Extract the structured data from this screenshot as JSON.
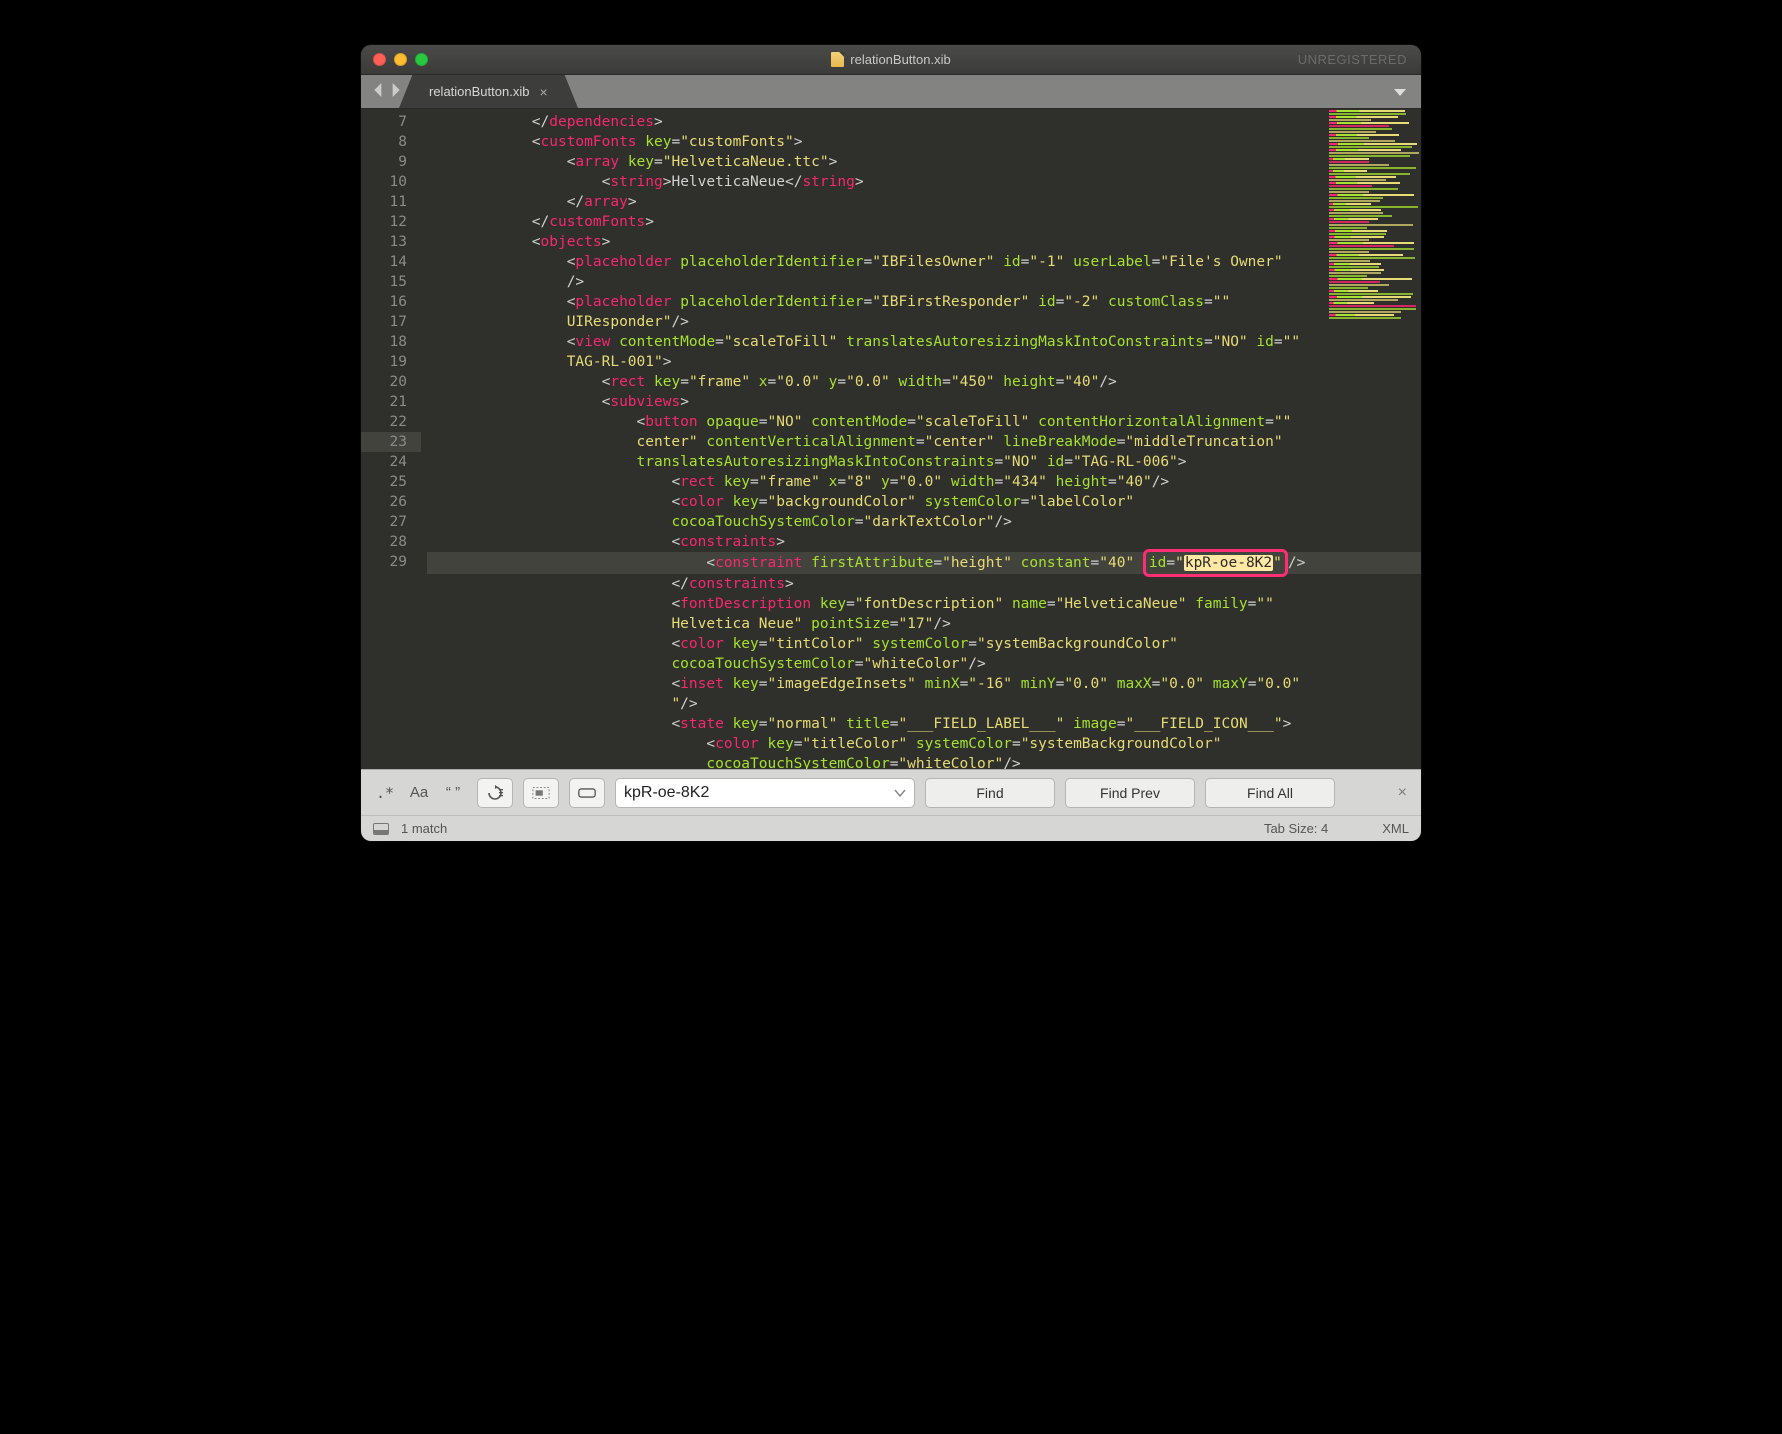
{
  "window": {
    "title": "relationButton.xib",
    "unregistered": "UNREGISTERED"
  },
  "tab": {
    "label": "relationButton.xib",
    "close": "×"
  },
  "gutter_start": 7,
  "highlight_line": 23,
  "lines": [
    {
      "n": 7,
      "indent": 3,
      "pre": "</",
      "tag": "dependencies",
      "post": ">"
    },
    {
      "n": 8,
      "indent": 3,
      "pre": "<",
      "tag": "customFonts",
      "attrs": [
        [
          "key",
          "customFonts"
        ]
      ],
      "post": ">"
    },
    {
      "n": 9,
      "indent": 4,
      "pre": "<",
      "tag": "array",
      "attrs": [
        [
          "key",
          "HelveticaNeue.ttc"
        ]
      ],
      "post": ">"
    },
    {
      "n": 10,
      "indent": 5,
      "pre": "<",
      "tag": "string",
      "post_text": ">HelveticaNeue</",
      "tag2": "string",
      "post2": ">"
    },
    {
      "n": 11,
      "indent": 4,
      "pre": "</",
      "tag": "array",
      "post": ">"
    },
    {
      "n": 12,
      "indent": 3,
      "pre": "</",
      "tag": "customFonts",
      "post": ">"
    },
    {
      "n": 13,
      "indent": 3,
      "pre": "<",
      "tag": "objects",
      "post": ">"
    },
    {
      "n": 14,
      "indent": 4,
      "pre": "<",
      "tag": "placeholder",
      "attrs": [
        [
          "placeholderIdentifier",
          "IBFilesOwner"
        ],
        [
          "id",
          "-1"
        ],
        [
          "userLabel",
          "File's Owner"
        ]
      ],
      "post": "",
      "wrap_close": "/>"
    },
    {
      "n": 15,
      "indent": 4,
      "pre": "<",
      "tag": "placeholder",
      "attrs": [
        [
          "placeholderIdentifier",
          "IBFirstResponder"
        ],
        [
          "id",
          "-2"
        ],
        [
          "customClass",
          ""
        ]
      ],
      "post": "",
      "wrap_text": "UIResponder\"",
      "wrap_close": "/>"
    },
    {
      "n": 16,
      "indent": 4,
      "pre": "<",
      "tag": "view",
      "attrs": [
        [
          "contentMode",
          "scaleToFill"
        ],
        [
          "translatesAutoresizingMaskIntoConstraints",
          "NO"
        ],
        [
          "id",
          ""
        ]
      ],
      "post": "",
      "wrap_text": "TAG-RL-001\"",
      "wrap_close": ">"
    },
    {
      "n": 17,
      "indent": 5,
      "pre": "<",
      "tag": "rect",
      "attrs": [
        [
          "key",
          "frame"
        ],
        [
          "x",
          "0.0"
        ],
        [
          "y",
          "0.0"
        ],
        [
          "width",
          "450"
        ],
        [
          "height",
          "40"
        ]
      ],
      "post": "/>"
    },
    {
      "n": 18,
      "indent": 5,
      "pre": "<",
      "tag": "subviews",
      "post": ">"
    },
    {
      "n": 19,
      "indent": 6,
      "pre": "<",
      "tag": "button",
      "attrs": [
        [
          "opaque",
          "NO"
        ],
        [
          "contentMode",
          "scaleToFill"
        ],
        [
          "contentHorizontalAlignment",
          ""
        ]
      ],
      "post": "",
      "wrap_lines": [
        "center\" contentVerticalAlignment=\"center\" lineBreakMode=\"middleTruncation\"",
        "translatesAutoresizingMaskIntoConstraints=\"NO\" id=\"TAG-RL-006\">"
      ]
    },
    {
      "n": 20,
      "indent": 7,
      "pre": "<",
      "tag": "rect",
      "attrs": [
        [
          "key",
          "frame"
        ],
        [
          "x",
          "8"
        ],
        [
          "y",
          "0.0"
        ],
        [
          "width",
          "434"
        ],
        [
          "height",
          "40"
        ]
      ],
      "post": "/>"
    },
    {
      "n": 21,
      "indent": 7,
      "pre": "<",
      "tag": "color",
      "attrs": [
        [
          "key",
          "backgroundColor"
        ],
        [
          "systemColor",
          "labelColor"
        ]
      ],
      "post": "",
      "wrap_lines": [
        "cocoaTouchSystemColor=\"darkTextColor\"/>"
      ]
    },
    {
      "n": 22,
      "indent": 7,
      "pre": "<",
      "tag": "constraints",
      "post": ">"
    },
    {
      "n": 23,
      "indent": 8,
      "pre": "<",
      "tag": "constraint",
      "attrs": [
        [
          "firstAttribute",
          "height"
        ],
        [
          "constant",
          "40"
        ]
      ],
      "post": "",
      "hit_attr": [
        "id",
        "kpR-oe-8K2"
      ],
      "post_end": "/>"
    },
    {
      "n": 24,
      "indent": 7,
      "pre": "</",
      "tag": "constraints",
      "post": ">"
    },
    {
      "n": 25,
      "indent": 7,
      "pre": "<",
      "tag": "fontDescription",
      "attrs": [
        [
          "key",
          "fontDescription"
        ],
        [
          "name",
          "HelveticaNeue"
        ],
        [
          "family",
          ""
        ]
      ],
      "post": "",
      "wrap_lines": [
        "Helvetica Neue\" pointSize=\"17\"/>"
      ]
    },
    {
      "n": 26,
      "indent": 7,
      "pre": "<",
      "tag": "color",
      "attrs": [
        [
          "key",
          "tintColor"
        ],
        [
          "systemColor",
          "systemBackgroundColor"
        ]
      ],
      "post": "",
      "wrap_lines": [
        "cocoaTouchSystemColor=\"whiteColor\"/>"
      ]
    },
    {
      "n": 27,
      "indent": 7,
      "pre": "<",
      "tag": "inset",
      "attrs": [
        [
          "key",
          "imageEdgeInsets"
        ],
        [
          "minX",
          "-16"
        ],
        [
          "minY",
          "0.0"
        ],
        [
          "maxX",
          "0.0"
        ],
        [
          "maxY",
          "0.0"
        ]
      ],
      "post": "",
      "wrap_lines": [
        "\"/>"
      ]
    },
    {
      "n": 28,
      "indent": 7,
      "pre": "<",
      "tag": "state",
      "attrs": [
        [
          "key",
          "normal"
        ],
        [
          "title",
          "___FIELD_LABEL___"
        ],
        [
          "image",
          "___FIELD_ICON___"
        ]
      ],
      "post": ">"
    },
    {
      "n": 29,
      "indent": 8,
      "pre": "<",
      "tag": "color",
      "attrs": [
        [
          "key",
          "titleColor"
        ],
        [
          "systemColor",
          "systemBackgroundColor"
        ]
      ],
      "post": "",
      "wrap_lines": [
        "cocoaTouchSystemColor=\"whiteColor\"/>"
      ]
    }
  ],
  "find": {
    "regex_label": ".*",
    "case_label": "Aa",
    "quotes_label": "“ ”",
    "wrap_label": "↻≡",
    "highlight_label": "▭",
    "inselection_label": "▭",
    "value": "kpR-oe-8K2",
    "find": "Find",
    "find_prev": "Find Prev",
    "find_all": "Find All",
    "close": "×"
  },
  "status": {
    "matches": "1 match",
    "tabsize": "Tab Size: 4",
    "syntax": "XML"
  }
}
